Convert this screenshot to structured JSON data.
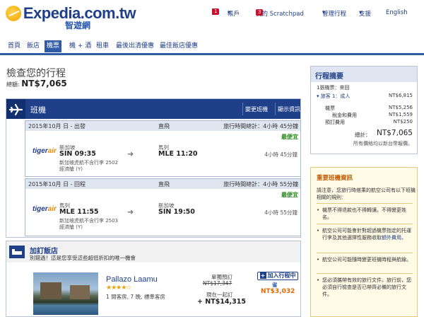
{
  "brand": {
    "name": "Expedia.com.tw",
    "subname": "智遊網"
  },
  "topnav": {
    "notif_count": "1",
    "account": "帳戶",
    "scratchpad": "我的 Scratchpad",
    "scratchpad_count": "3",
    "manage": "管理行程",
    "support": "支援",
    "language": "English"
  },
  "tabs": [
    "首頁",
    "飯店",
    "機票",
    "機 + 酒",
    "租車",
    "最後出清優惠",
    "最佳飯店優惠"
  ],
  "active_tab": "機票",
  "page": {
    "title": "檢查您的行程",
    "total_label": "總額:",
    "total_value": "NT$7,065"
  },
  "flights": {
    "title": "班機",
    "change_link": "變更班機",
    "show_link": "顯示資訊",
    "outbound": {
      "date": "2015年10月 日 - 出發",
      "type": "直飛",
      "total_time": "旅行時間總計：4小時 45分鐘",
      "best": "最便宜",
      "airline": "tigerair",
      "from_city": "新加坡",
      "from_time": "SIN 09:35",
      "to_city": "馬列",
      "to_time": "MLE 11:20",
      "duration": "4小時 45分鐘",
      "operator": "新加坡虎航不含行李 2502",
      "cabin": "經濟艙 (Y)"
    },
    "inbound": {
      "date": "2015年10月 日 - 回程",
      "type": "直飛",
      "total_time": "旅行時間總計：4小時 55分鐘",
      "best": "最便宜",
      "airline": "tigerair",
      "from_city": "馬列",
      "from_time": "MLE 11:55",
      "to_city": "新加坡",
      "to_time": "SIN 19:50",
      "duration": "4小時 55分鐘",
      "operator": "新加坡虎航不含行李 2503",
      "cabin": "經濟艙 (Y)"
    }
  },
  "hotel": {
    "section_title": "加訂飯店",
    "section_sub": "別錯過！這是您享受這些超低折扣的唯一機會",
    "name": "Pallazo Laamu",
    "stars": "★★★★☆",
    "room": "1 間客房, 7 晚, 標準客房",
    "standalone_label": "單獨預訂",
    "standalone_price": "NT$17,347",
    "together_label": "現在一起訂",
    "together_price": "+ NT$14,315",
    "add_button": "加入行程中",
    "save_label": "省",
    "save_price": "NT$3,032"
  },
  "summary": {
    "title": "行程摘要",
    "tickets": "1張機票：來回",
    "traveler": "旅客 1：成人",
    "traveler_amount": "NT$6,815",
    "fare_label": "機票",
    "fare_amount": "NT$5,256",
    "tax_label": "稅金和費用",
    "tax_amount": "NT$1,559",
    "booking_label": "預訂費用",
    "booking_amount": "NT$250",
    "total_label": "總計：",
    "total_amount": "NT$7,065",
    "currency_note": "所有價格均以新台幣報價。"
  },
  "info": {
    "title": "重要班機資訊",
    "intro": "請注意，您旅行時搭乘的航空公司有以下班機相關的規則：",
    "item1": "機票不得退款也不得轉讓。不得變更姓名。",
    "item2_a": "航空公司可能會針對超過機票指定的托運行李及其他選擇性服務收取",
    "item2_link": "額外費用",
    "item3": "航空公司可能隨時變更班機時程與航線。",
    "item4": "您必須攜帶有效的旅行文件。旅行前，您必須自行檢查是否已帶齊必備的旅行文件。"
  }
}
